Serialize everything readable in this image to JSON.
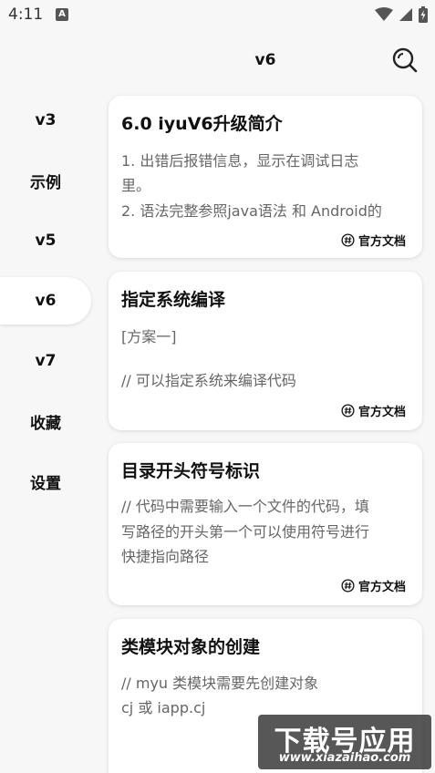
{
  "status_bar": {
    "time": "4:11",
    "badge": "A"
  },
  "app_bar": {
    "title": "v6"
  },
  "sidebar": {
    "items": [
      {
        "label": "v3",
        "active": false
      },
      {
        "label": "示例",
        "active": false
      },
      {
        "label": "v5",
        "active": false
      },
      {
        "label": "v6",
        "active": true
      },
      {
        "label": "v7",
        "active": false
      },
      {
        "label": "收藏",
        "active": false
      },
      {
        "label": "设置",
        "active": false
      }
    ]
  },
  "cards": [
    {
      "title": "6.0 iyuV6升级简介",
      "lines": [
        "1. 出错后报错信息，显示在调试日志",
        "里。",
        "2. 语法完整参照java语法 和 Android的"
      ],
      "link": "官方文档"
    },
    {
      "title": "指定系统编译",
      "lines": [
        "[方案一]",
        "",
        "// 可以指定系统来编译代码"
      ],
      "link": "官方文档"
    },
    {
      "title": "目录开头符号标识",
      "lines": [
        "// 代码中需要输入一个文件的代码，填",
        "写路径的开头第一个可以使用符号进行",
        "快捷指向路径"
      ],
      "link": "官方文档"
    },
    {
      "title": "类模块对象的创建",
      "lines": [
        "// myu 类模块需要先创建对象",
        "cj 或  iapp.cj"
      ],
      "link": ""
    }
  ],
  "watermark": {
    "main": "下载号应用",
    "url": "www.xiazaihao.com"
  },
  "colors": {
    "background": "#f7f7f7",
    "card": "#ffffff",
    "text": "#111111",
    "secondary_text": "#666666"
  }
}
